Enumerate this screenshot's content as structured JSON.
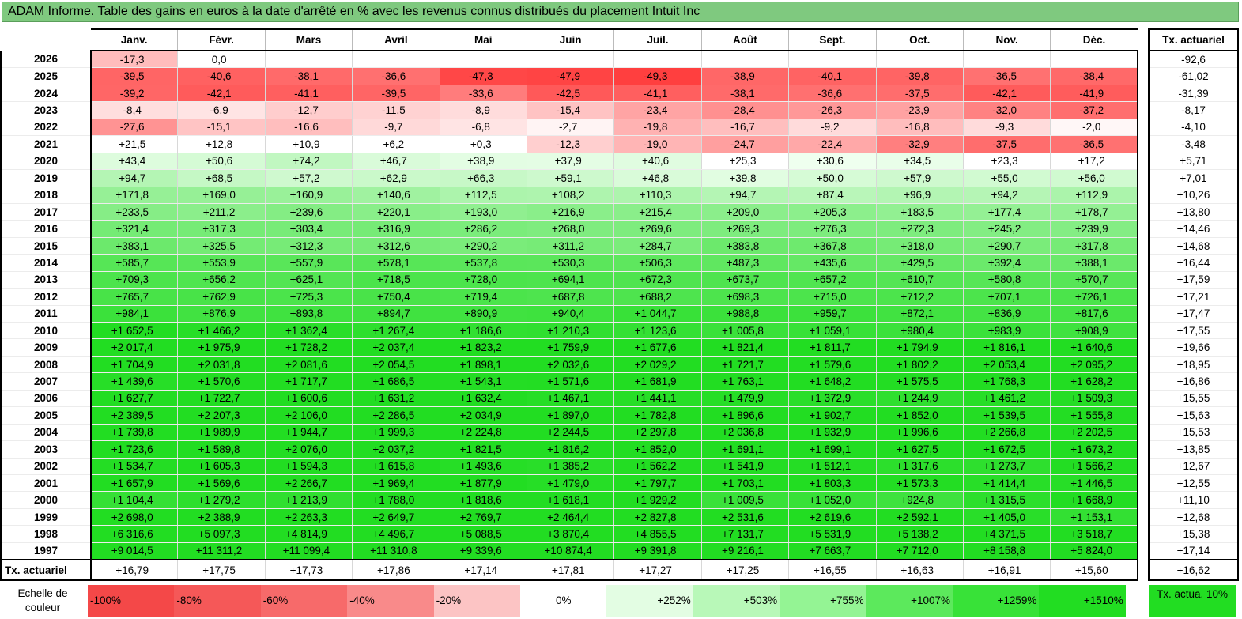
{
  "title": "ADAM Informe. Table des gains en euros à la date d'arrêté en % avec les revenus connus distribués du placement Intuit Inc",
  "chart_data": {
    "type": "table",
    "columns": [
      "Janv.",
      "Févr.",
      "Mars",
      "Avril",
      "Mai",
      "Juin",
      "Juil.",
      "Août",
      "Sept.",
      "Oct.",
      "Nov.",
      "Déc."
    ],
    "side_header": "Tx. actuariel",
    "rows": [
      {
        "year": "2026",
        "values": [
          "-17,3",
          "0,0",
          "",
          "",
          "",
          "",
          "",
          "",
          "",
          "",
          "",
          ""
        ],
        "actuarial": "-92,6"
      },
      {
        "year": "2025",
        "values": [
          "-39,5",
          "-40,6",
          "-38,1",
          "-36,6",
          "-47,3",
          "-47,9",
          "-49,3",
          "-38,9",
          "-40,1",
          "-39,8",
          "-36,5",
          "-38,4"
        ],
        "actuarial": "-61,02"
      },
      {
        "year": "2024",
        "values": [
          "-39,2",
          "-42,1",
          "-41,1",
          "-39,5",
          "-33,6",
          "-42,5",
          "-41,1",
          "-38,1",
          "-36,6",
          "-37,5",
          "-42,1",
          "-41,9"
        ],
        "actuarial": "-31,39"
      },
      {
        "year": "2023",
        "values": [
          "-8,4",
          "-6,9",
          "-12,7",
          "-11,5",
          "-8,9",
          "-15,4",
          "-23,4",
          "-28,4",
          "-26,3",
          "-23,9",
          "-32,0",
          "-37,2"
        ],
        "actuarial": "-8,17"
      },
      {
        "year": "2022",
        "values": [
          "-27,6",
          "-15,1",
          "-16,6",
          "-9,7",
          "-6,8",
          "-2,7",
          "-19,8",
          "-16,7",
          "-9,2",
          "-16,8",
          "-9,3",
          "-2,0"
        ],
        "actuarial": "-4,10"
      },
      {
        "year": "2021",
        "values": [
          "+21,5",
          "+12,8",
          "+10,9",
          "+6,2",
          "+0,3",
          "-12,3",
          "-19,0",
          "-24,7",
          "-22,4",
          "-32,9",
          "-37,5",
          "-36,5"
        ],
        "actuarial": "-3,48"
      },
      {
        "year": "2020",
        "values": [
          "+43,4",
          "+50,6",
          "+74,2",
          "+46,7",
          "+38,9",
          "+37,9",
          "+40,6",
          "+25,3",
          "+30,6",
          "+34,5",
          "+23,3",
          "+17,2"
        ],
        "actuarial": "+5,71"
      },
      {
        "year": "2019",
        "values": [
          "+94,7",
          "+68,5",
          "+57,2",
          "+62,9",
          "+66,3",
          "+59,1",
          "+46,8",
          "+39,8",
          "+50,0",
          "+57,9",
          "+55,0",
          "+56,0"
        ],
        "actuarial": "+7,01"
      },
      {
        "year": "2018",
        "values": [
          "+171,8",
          "+169,0",
          "+160,9",
          "+140,6",
          "+112,5",
          "+108,2",
          "+110,3",
          "+94,7",
          "+87,4",
          "+96,9",
          "+94,2",
          "+112,9"
        ],
        "actuarial": "+10,26"
      },
      {
        "year": "2017",
        "values": [
          "+233,5",
          "+211,2",
          "+239,6",
          "+220,1",
          "+193,0",
          "+216,9",
          "+215,4",
          "+209,0",
          "+205,3",
          "+183,5",
          "+177,4",
          "+178,7"
        ],
        "actuarial": "+13,80"
      },
      {
        "year": "2016",
        "values": [
          "+321,4",
          "+317,3",
          "+303,4",
          "+316,9",
          "+286,2",
          "+268,0",
          "+269,6",
          "+269,3",
          "+276,3",
          "+272,3",
          "+245,2",
          "+239,9"
        ],
        "actuarial": "+14,46"
      },
      {
        "year": "2015",
        "values": [
          "+383,1",
          "+325,5",
          "+312,3",
          "+312,6",
          "+290,2",
          "+311,2",
          "+284,7",
          "+383,8",
          "+367,8",
          "+318,0",
          "+290,7",
          "+317,8"
        ],
        "actuarial": "+14,68"
      },
      {
        "year": "2014",
        "values": [
          "+585,7",
          "+553,9",
          "+557,9",
          "+578,1",
          "+537,8",
          "+530,3",
          "+506,3",
          "+487,3",
          "+435,6",
          "+429,5",
          "+392,4",
          "+388,1"
        ],
        "actuarial": "+16,44"
      },
      {
        "year": "2013",
        "values": [
          "+709,3",
          "+656,2",
          "+625,1",
          "+718,5",
          "+728,0",
          "+694,1",
          "+672,3",
          "+673,7",
          "+657,2",
          "+610,7",
          "+580,8",
          "+570,7"
        ],
        "actuarial": "+17,59"
      },
      {
        "year": "2012",
        "values": [
          "+765,7",
          "+762,9",
          "+725,3",
          "+750,4",
          "+719,4",
          "+687,8",
          "+688,2",
          "+698,3",
          "+715,0",
          "+712,2",
          "+707,1",
          "+726,1"
        ],
        "actuarial": "+17,21"
      },
      {
        "year": "2011",
        "values": [
          "+984,1",
          "+876,9",
          "+893,8",
          "+894,7",
          "+890,9",
          "+940,4",
          "+1 044,7",
          "+988,8",
          "+959,7",
          "+872,1",
          "+836,9",
          "+817,6"
        ],
        "actuarial": "+17,47"
      },
      {
        "year": "2010",
        "values": [
          "+1 652,5",
          "+1 466,2",
          "+1 362,4",
          "+1 267,4",
          "+1 186,6",
          "+1 210,3",
          "+1 123,6",
          "+1 005,8",
          "+1 059,1",
          "+980,4",
          "+983,9",
          "+908,9"
        ],
        "actuarial": "+17,55"
      },
      {
        "year": "2009",
        "values": [
          "+2 017,4",
          "+1 975,9",
          "+1 728,2",
          "+2 037,4",
          "+1 823,2",
          "+1 759,9",
          "+1 677,6",
          "+1 821,4",
          "+1 811,7",
          "+1 794,9",
          "+1 816,1",
          "+1 640,6"
        ],
        "actuarial": "+19,66"
      },
      {
        "year": "2008",
        "values": [
          "+1 704,9",
          "+2 031,8",
          "+2 081,6",
          "+2 054,5",
          "+1 898,1",
          "+2 032,6",
          "+2 029,2",
          "+1 721,7",
          "+1 579,6",
          "+1 802,2",
          "+2 053,4",
          "+2 095,2"
        ],
        "actuarial": "+18,95"
      },
      {
        "year": "2007",
        "values": [
          "+1 439,6",
          "+1 570,6",
          "+1 717,7",
          "+1 686,5",
          "+1 543,1",
          "+1 571,6",
          "+1 681,9",
          "+1 763,1",
          "+1 648,2",
          "+1 575,5",
          "+1 768,3",
          "+1 628,2"
        ],
        "actuarial": "+16,86"
      },
      {
        "year": "2006",
        "values": [
          "+1 627,7",
          "+1 722,7",
          "+1 600,6",
          "+1 631,2",
          "+1 632,4",
          "+1 467,1",
          "+1 441,1",
          "+1 479,9",
          "+1 372,9",
          "+1 244,9",
          "+1 461,2",
          "+1 509,3"
        ],
        "actuarial": "+15,55"
      },
      {
        "year": "2005",
        "values": [
          "+2 389,5",
          "+2 207,3",
          "+2 106,0",
          "+2 286,5",
          "+2 034,9",
          "+1 897,0",
          "+1 782,8",
          "+1 896,6",
          "+1 902,7",
          "+1 852,0",
          "+1 539,5",
          "+1 555,8"
        ],
        "actuarial": "+15,63"
      },
      {
        "year": "2004",
        "values": [
          "+1 739,8",
          "+1 989,9",
          "+1 944,7",
          "+1 999,3",
          "+2 224,8",
          "+2 244,5",
          "+2 297,8",
          "+2 036,8",
          "+1 932,9",
          "+1 996,6",
          "+2 266,8",
          "+2 202,5"
        ],
        "actuarial": "+15,53"
      },
      {
        "year": "2003",
        "values": [
          "+1 723,6",
          "+1 589,8",
          "+2 076,0",
          "+2 037,2",
          "+1 821,5",
          "+1 816,2",
          "+1 852,0",
          "+1 691,1",
          "+1 699,1",
          "+1 627,5",
          "+1 672,5",
          "+1 673,2"
        ],
        "actuarial": "+13,85"
      },
      {
        "year": "2002",
        "values": [
          "+1 534,7",
          "+1 605,3",
          "+1 594,3",
          "+1 615,8",
          "+1 493,6",
          "+1 385,2",
          "+1 562,2",
          "+1 541,9",
          "+1 512,1",
          "+1 317,6",
          "+1 273,7",
          "+1 566,2"
        ],
        "actuarial": "+12,67"
      },
      {
        "year": "2001",
        "values": [
          "+1 657,9",
          "+1 569,6",
          "+2 266,7",
          "+1 969,4",
          "+1 877,9",
          "+1 479,0",
          "+1 797,7",
          "+1 703,1",
          "+1 803,3",
          "+1 573,3",
          "+1 414,4",
          "+1 446,5"
        ],
        "actuarial": "+12,55"
      },
      {
        "year": "2000",
        "values": [
          "+1 104,4",
          "+1 279,2",
          "+1 213,9",
          "+1 788,0",
          "+1 818,6",
          "+1 618,1",
          "+1 929,2",
          "+1 009,5",
          "+1 052,0",
          "+924,8",
          "+1 315,5",
          "+1 668,9"
        ],
        "actuarial": "+11,10"
      },
      {
        "year": "1999",
        "values": [
          "+2 698,0",
          "+2 388,9",
          "+2 263,3",
          "+2 649,7",
          "+2 769,7",
          "+2 464,4",
          "+2 827,8",
          "+2 531,6",
          "+2 619,6",
          "+2 592,1",
          "+1 405,0",
          "+1 153,1"
        ],
        "actuarial": "+12,68"
      },
      {
        "year": "1998",
        "values": [
          "+6 316,6",
          "+5 097,3",
          "+4 814,9",
          "+4 496,7",
          "+5 088,5",
          "+3 870,4",
          "+4 855,5",
          "+7 131,7",
          "+5 531,9",
          "+5 138,2",
          "+4 371,5",
          "+3 518,7"
        ],
        "actuarial": "+15,38"
      },
      {
        "year": "1997",
        "values": [
          "+9 014,5",
          "+11 311,2",
          "+11 099,4",
          "+11 310,8",
          "+9 339,6",
          "+10 874,4",
          "+9 391,8",
          "+9 216,1",
          "+7 663,7",
          "+7 712,0",
          "+8 158,8",
          "+5 824,0"
        ],
        "actuarial": "+17,14"
      }
    ],
    "footer": {
      "label": "Tx. actuariel",
      "values": [
        "+16,79",
        "+17,75",
        "+17,73",
        "+17,86",
        "+17,14",
        "+17,81",
        "+17,27",
        "+17,25",
        "+16,55",
        "+16,63",
        "+16,91",
        "+15,60"
      ],
      "actuarial": "+16,62"
    },
    "legend": {
      "label": "Echelle de couleur",
      "items": [
        {
          "label": "-100%",
          "color": "#f44848"
        },
        {
          "label": "-80%",
          "color": "#f55858"
        },
        {
          "label": "-60%",
          "color": "#f76a6a"
        },
        {
          "label": "-40%",
          "color": "#f98a8a"
        },
        {
          "label": "-20%",
          "color": "#fcc4c4"
        },
        {
          "label": "0%",
          "color": "#ffffff"
        },
        {
          "label": "+252%",
          "color": "#e3fde3"
        },
        {
          "label": "+503%",
          "color": "#b8f8b8"
        },
        {
          "label": "+755%",
          "color": "#94f494"
        },
        {
          "label": "+1007%",
          "color": "#5ce95c"
        },
        {
          "label": "+1259%",
          "color": "#38e238"
        },
        {
          "label": "+1510%",
          "color": "#22dd22"
        }
      ],
      "side_label": "Tx. actua. 10%",
      "side_color": "#22dd22"
    }
  }
}
